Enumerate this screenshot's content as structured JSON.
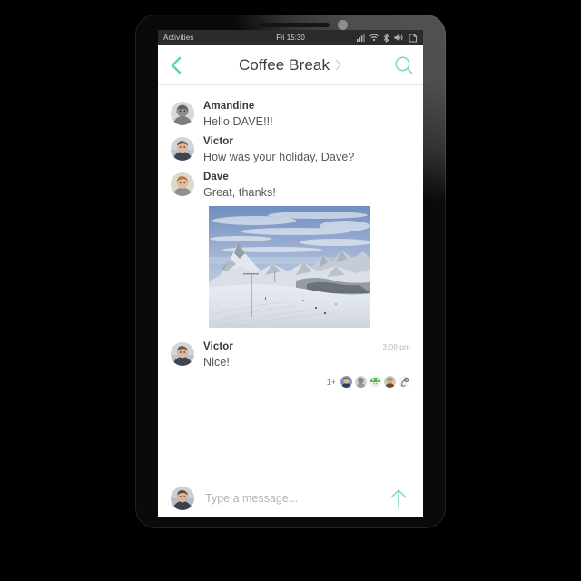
{
  "os_bar": {
    "activities_label": "Activities",
    "clock": "Fri 15:30",
    "indicators": [
      "signal-icon",
      "wifi-icon",
      "bluetooth-icon",
      "volume-icon",
      "battery-icon"
    ]
  },
  "header": {
    "back_icon": "chevron-left-icon",
    "title": "Coffee Break",
    "title_chevron_icon": "chevron-right-icon",
    "search_icon": "search-icon"
  },
  "messages": [
    {
      "sender": "Amandine",
      "text": "Hello DAVE!!!",
      "avatar": "avatar-amandine",
      "time": ""
    },
    {
      "sender": "Victor",
      "text": "How was your holiday, Dave?",
      "avatar": "avatar-victor",
      "time": ""
    },
    {
      "sender": "Dave",
      "text": "Great, thanks!",
      "avatar": "avatar-dave",
      "time": ""
    }
  ],
  "attachment": {
    "type": "photo",
    "alt": "Snowy mountain ski slope with peak"
  },
  "last_message": {
    "sender": "Victor",
    "text": "Nice!",
    "time": "3:08 pm",
    "avatar": "avatar-victor"
  },
  "reactions": {
    "count_label": "1+",
    "avatars": [
      "reaction-avatar-1",
      "reaction-avatar-2",
      "reaction-avatar-3",
      "reaction-avatar-4",
      "reaction-avatar-5"
    ]
  },
  "composer": {
    "placeholder": "Type a message...",
    "value": "",
    "send_icon": "arrow-up-icon",
    "avatar": "avatar-self"
  },
  "colors": {
    "accent": "#6fd6a4",
    "accent_light": "#b6e9cf",
    "topbar_bg": "#2b2b2b",
    "screen_bg": "#ffffff",
    "title_text": "#3b3b3b",
    "body_text": "#565656",
    "muted_text": "#b9b9b9",
    "device_body": "#0a0a0a"
  }
}
